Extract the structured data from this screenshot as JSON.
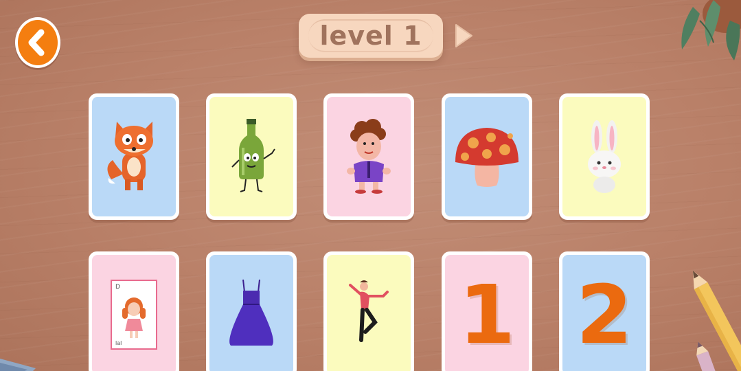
{
  "header": {
    "level_label": "level 1"
  },
  "colors": {
    "accent_orange": "#f47e10",
    "card_blue": "#bad9f7",
    "card_yellow": "#fbfbbe",
    "card_pink": "#fbd4e2",
    "plaque": "#f7d7bf",
    "level_text": "#a0735d"
  },
  "cards": [
    {
      "icon": "fox-icon",
      "bg": "blue"
    },
    {
      "icon": "bottle-character-icon",
      "bg": "yellow"
    },
    {
      "icon": "curly-hair-man-icon",
      "bg": "pink"
    },
    {
      "icon": "mushroom-icon",
      "bg": "blue"
    },
    {
      "icon": "rabbit-icon",
      "bg": "yellow"
    },
    {
      "icon": "girl-picture-card-icon",
      "bg": "pink"
    },
    {
      "icon": "dress-icon",
      "bg": "blue"
    },
    {
      "icon": "dancer-icon",
      "bg": "yellow"
    },
    {
      "icon": "number-one-icon",
      "bg": "pink",
      "text": "1"
    },
    {
      "icon": "number-two-icon",
      "bg": "blue",
      "text": "2"
    }
  ]
}
